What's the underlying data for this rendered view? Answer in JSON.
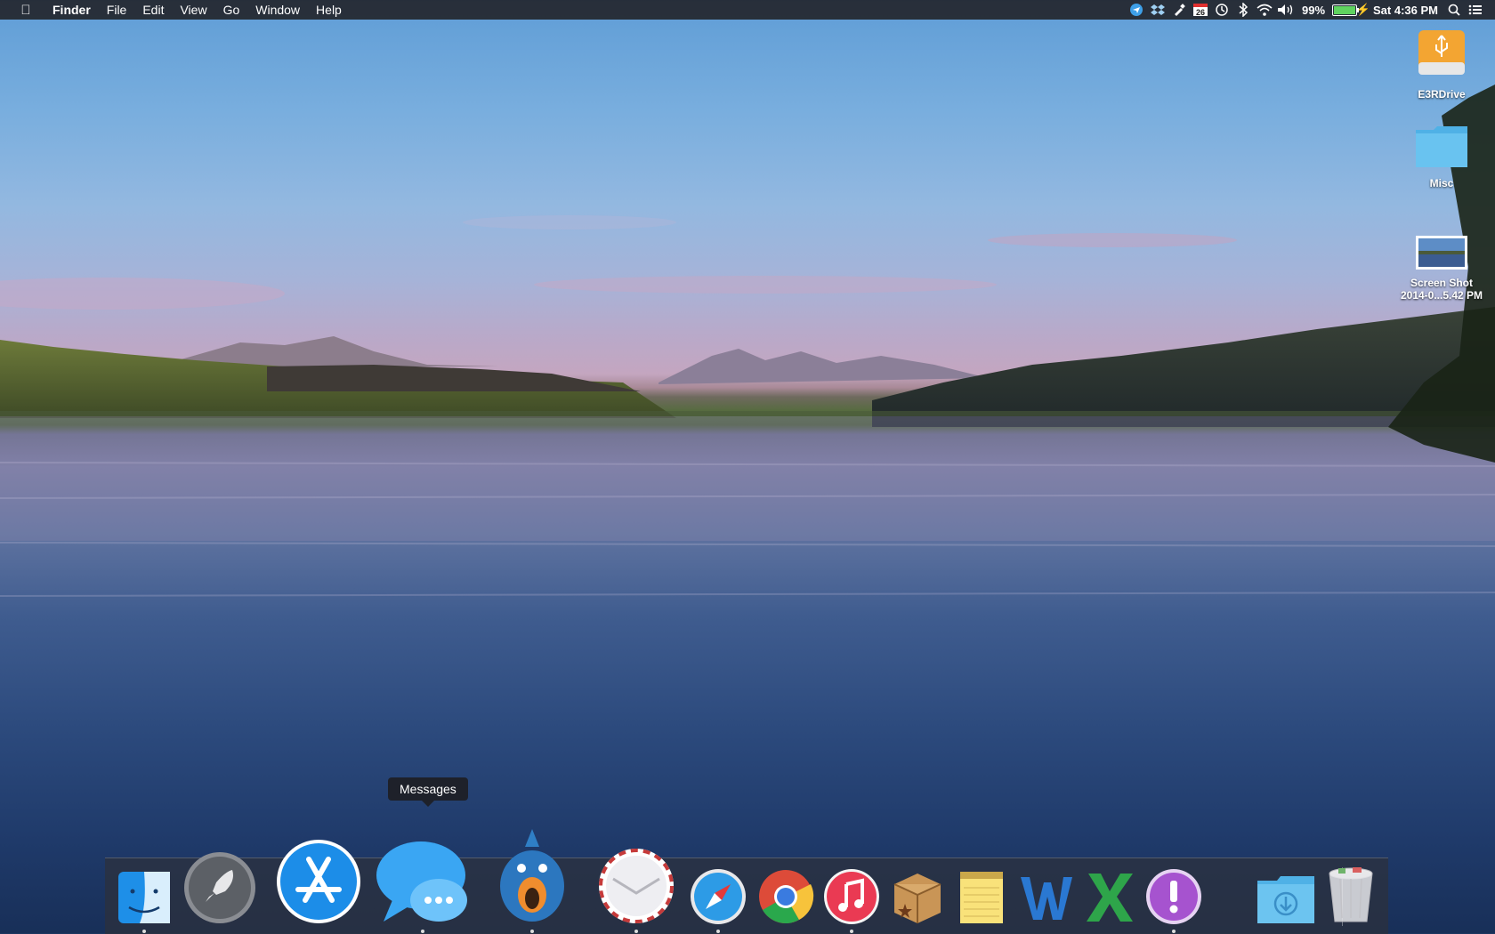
{
  "menubar": {
    "apple_icon": "apple-icon",
    "app_name": "Finder",
    "menus": [
      "File",
      "Edit",
      "View",
      "Go",
      "Window",
      "Help"
    ],
    "status": {
      "battery_percent": "99%",
      "battery_level": 0.99,
      "calendar_day": "26",
      "clock": "Sat 4:36 PM"
    }
  },
  "desktop": {
    "icons": [
      {
        "label": "E3RDrive",
        "icon": "external-drive-icon"
      },
      {
        "label": "Misc",
        "icon": "folder-icon"
      },
      {
        "label_line1": "Screen Shot",
        "label_line2": "2014-0...5.42 PM",
        "icon": "screenshot-file-icon"
      }
    ]
  },
  "tooltip": "Messages",
  "dock": {
    "apps": [
      {
        "name": "Finder",
        "running": true
      },
      {
        "name": "Launchpad",
        "running": false
      },
      {
        "name": "App Store",
        "running": false
      },
      {
        "name": "Messages",
        "running": true
      },
      {
        "name": "Tweetbot",
        "running": true
      },
      {
        "name": "Airmail",
        "running": true
      },
      {
        "name": "Safari",
        "running": true
      },
      {
        "name": "Chrome",
        "running": false
      },
      {
        "name": "iTunes",
        "running": true
      },
      {
        "name": "Delivery",
        "running": false
      },
      {
        "name": "Notes",
        "running": false
      },
      {
        "name": "Word",
        "running": false
      },
      {
        "name": "Excel",
        "running": false
      },
      {
        "name": "Feedback",
        "running": true
      },
      {
        "name": "Downloads",
        "running": false
      },
      {
        "name": "Trash",
        "running": false
      }
    ]
  }
}
